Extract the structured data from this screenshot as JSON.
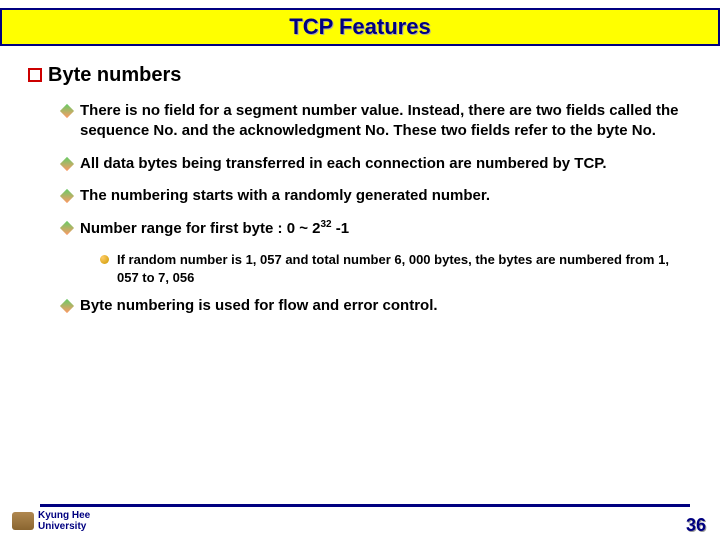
{
  "title": "TCP Features",
  "heading": "Byte numbers",
  "bullets": {
    "b1": "There is no field for a segment number value. Instead, there are two fields called the sequence No. and the acknowledgment No. These two fields refer to the byte No.",
    "b2": "All data bytes being transferred in each connection are numbered by TCP.",
    "b3": "The numbering starts with a randomly generated number.",
    "b4_pre": "Number range for first byte : 0 ~ 2",
    "b4_exp": "32",
    "b4_post": " -1",
    "b4_sub": "If random number is 1, 057 and total number 6, 000 bytes, the bytes are numbered from 1, 057 to 7, 056",
    "b5": "Byte numbering is used for flow and error control."
  },
  "footer": {
    "university_line1": "Kyung Hee",
    "university_line2": "University",
    "page": "36"
  }
}
